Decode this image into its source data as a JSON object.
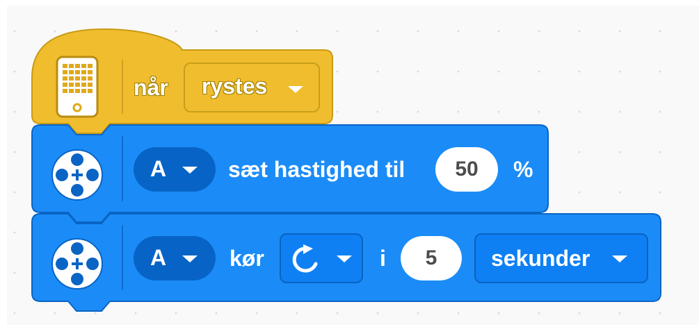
{
  "hat_block": {
    "label": "når",
    "dropdown_value": "rystes",
    "icon": "hub-display-icon",
    "color": "#f0bd2f"
  },
  "speed_block": {
    "port": "A",
    "label": "sæt hastighed til",
    "value": "50",
    "unit": "%",
    "icon": "motor-icon",
    "color": "#1b8cf7"
  },
  "run_block": {
    "port": "A",
    "label_run": "kør",
    "direction_icon": "clockwise-arrow-icon",
    "label_for": "i",
    "value": "5",
    "unit_dropdown": "sekunder",
    "icon": "motor-icon",
    "color": "#1b8cf7"
  }
}
